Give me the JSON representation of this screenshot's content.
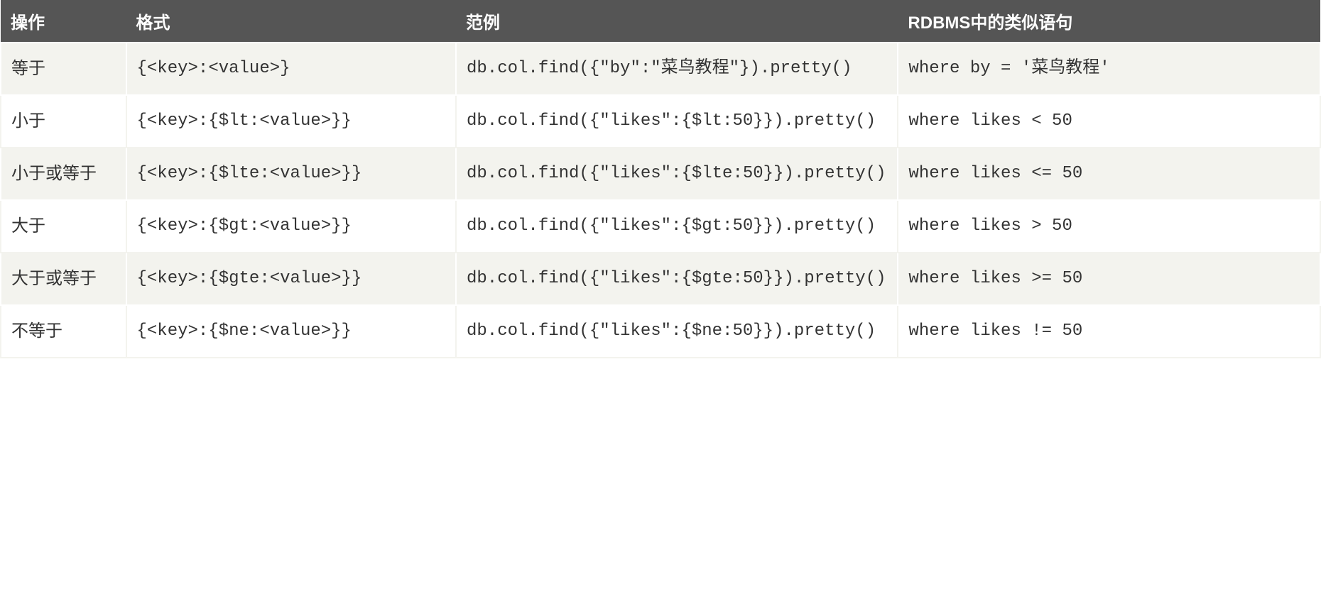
{
  "table": {
    "headers": {
      "operation": "操作",
      "format": "格式",
      "example": "范例",
      "rdbms": "RDBMS中的类似语句"
    },
    "rows": [
      {
        "operation": "等于",
        "format": "{<key>:<value>}",
        "example": "db.col.find({\"by\":\"菜鸟教程\"}).pretty()",
        "rdbms": "where by = '菜鸟教程'"
      },
      {
        "operation": "小于",
        "format": "{<key>:{$lt:<value>}}",
        "example": "db.col.find({\"likes\":{$lt:50}}).pretty()",
        "rdbms": "where likes < 50"
      },
      {
        "operation": "小于或等于",
        "format": "{<key>:{$lte:<value>}}",
        "example": "db.col.find({\"likes\":{$lte:50}}).pretty()",
        "rdbms": "where likes <= 50"
      },
      {
        "operation": "大于",
        "format": "{<key>:{$gt:<value>}}",
        "example": "db.col.find({\"likes\":{$gt:50}}).pretty()",
        "rdbms": "where likes > 50"
      },
      {
        "operation": "大于或等于",
        "format": "{<key>:{$gte:<value>}}",
        "example": "db.col.find({\"likes\":{$gte:50}}).pretty()",
        "rdbms": "where likes >= 50"
      },
      {
        "operation": "不等于",
        "format": "{<key>:{$ne:<value>}}",
        "example": "db.col.find({\"likes\":{$ne:50}}).pretty()",
        "rdbms": "where likes != 50"
      }
    ]
  }
}
